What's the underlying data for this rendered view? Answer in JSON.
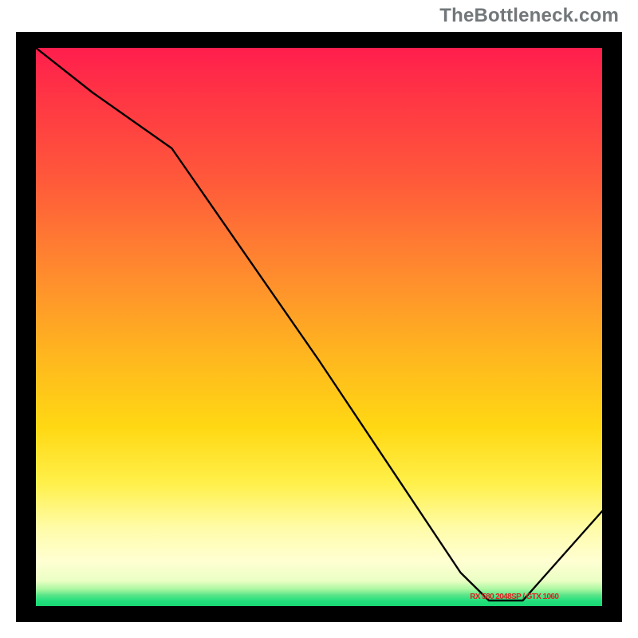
{
  "attribution": "TheBottleneck.com",
  "notch_text": "RX 580 2048SP / GTX 1060",
  "colors": {
    "frame": "#000000",
    "curve": "#000000",
    "label": "#e02020"
  },
  "chart_data": {
    "type": "line",
    "title": "",
    "xlabel": "",
    "ylabel": "",
    "xlim": [
      0,
      100
    ],
    "ylim": [
      0,
      100
    ],
    "series": [
      {
        "name": "bottleneck-curve",
        "x": [
          0,
          10,
          24,
          50,
          75,
          80,
          86,
          100
        ],
        "y": [
          100,
          92,
          82,
          44,
          6,
          1,
          1,
          17
        ]
      }
    ],
    "optimal_band_x": [
      80,
      86
    ],
    "annotations": [
      {
        "text": "RX 580 2048SP / GTX 1060",
        "x": 83,
        "y": 1
      }
    ]
  }
}
